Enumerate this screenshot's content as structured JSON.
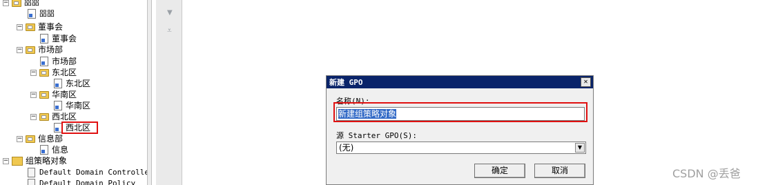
{
  "tree": {
    "items": [
      {
        "label": "㗊㗊",
        "icon": "ou-folder-icon",
        "expander": "⊟",
        "mono": true
      },
      {
        "label": "㗊㗊",
        "icon": "gpo-link-icon",
        "mono": true
      },
      {
        "label": "董事会",
        "icon": "ou-folder-icon",
        "expander": "⊟"
      },
      {
        "label": "董事会",
        "icon": "gpo-link-icon"
      },
      {
        "label": "市场部",
        "icon": "ou-folder-icon",
        "expander": "⊟"
      },
      {
        "label": "市场部",
        "icon": "gpo-link-icon"
      },
      {
        "label": "东北区",
        "icon": "ou-folder-icon",
        "expander": "⊟"
      },
      {
        "label": "东北区",
        "icon": "gpo-link-icon"
      },
      {
        "label": "华南区",
        "icon": "ou-folder-icon",
        "expander": "⊟"
      },
      {
        "label": "华南区",
        "icon": "gpo-link-icon"
      },
      {
        "label": "西北区",
        "icon": "ou-folder-icon",
        "expander": "⊟"
      },
      {
        "label": "西北区",
        "icon": "gpo-link-icon",
        "highlighted": true
      },
      {
        "label": "信息部",
        "icon": "ou-folder-icon",
        "expander": "⊟"
      },
      {
        "label": "信息",
        "icon": "gpo-link-icon"
      },
      {
        "label": "组策略对象",
        "icon": "gpo-container-icon",
        "expander": "⊟"
      },
      {
        "label": "Default Domain Controllers",
        "icon": "gpo-object-icon",
        "mono": true
      },
      {
        "label": "Default Domain Policy",
        "icon": "gpo-object-icon",
        "mono": true
      }
    ]
  },
  "dialog": {
    "title": "新建 GPO",
    "close_glyph": "✕",
    "name_label": "名称(N):",
    "name_value": "新建组策略对象",
    "starter_label": "源 Starter GPO(S):",
    "starter_value": "(无)",
    "ok_label": "确定",
    "cancel_label": "取消"
  },
  "toolbar": {
    "arrow1": "▼",
    "arrow2": "⩡"
  },
  "watermark": "CSDN @丢爸",
  "colors": {
    "highlight_box": "#e01010",
    "title_bar": "#0a246a",
    "selection": "#3169c6"
  }
}
